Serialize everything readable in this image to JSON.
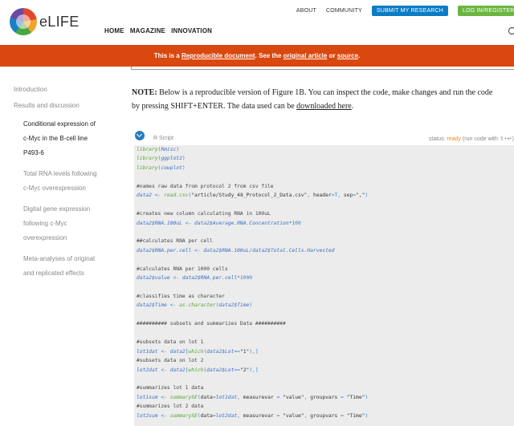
{
  "header": {
    "logo_text": "eLIFE",
    "utility_links": [
      "ABOUT",
      "COMMUNITY"
    ],
    "submit_label": "SUBMIT MY RESEARCH",
    "login_label": "LOG IN/REGISTER",
    "nav": [
      "HOME",
      "MAGAZINE",
      "INNOVATION"
    ]
  },
  "banner": {
    "prefix": "This is a ",
    "link1": "Reproducible document",
    "mid": ". See the ",
    "link2": "original article",
    "or": " or ",
    "link3": "source",
    "suffix": "."
  },
  "sidebar": {
    "items": [
      "Introduction",
      "Results and discussion",
      "Conditional expression of",
      "c-Myc in the B-cell line",
      "P493-6",
      "Total RNA levels following",
      "c-Myc overexpression",
      "Digital gene expression",
      "following c-Myc",
      "overexpression",
      "Meta-analyses of original",
      "and replicated effects"
    ]
  },
  "note": {
    "bold": "NOTE:",
    "text": " Below is a reproducible version of Figure 1B. You can inspect the code, make changes and run the code by pressing SHIFT+ENTER. The data used can be ",
    "link": "downloaded here",
    "suffix": "."
  },
  "code_panel": {
    "label": "R Script",
    "status_prefix": "status: ",
    "status_value": "ready",
    "status_suffix": " (run code with ⇧+↵)",
    "colors": {
      "function": "#55a630",
      "variable": "#3a6fc4",
      "background": "#ececec",
      "accent": "#2a7ac0"
    },
    "lines": [
      "library(Rmisc)",
      "library(ggplot2)",
      "library(cowplot)",
      "",
      "#names raw data from protocol 2 from csv file",
      "data2 <- read.csv(\"article/Study_48_Protocol_2_Data.csv\", header=T, sep=\",\")",
      "",
      "#creates new column calculating RNA in 100uL",
      "data2$RNA.100uL <- data2$Average.RNA.Concentration*100",
      "",
      "##calculates RNA per cell",
      "data2$RNA.per.cell <- data2$RNA.100uL/data2$Total.Cells.Harvested",
      "",
      "#calculates RNA per 1000 cells",
      "data2$value <- data2$RNA.per.cell*1000",
      "",
      "#classifies time as character",
      "data2$Time <- as.character(data2$Time)",
      "",
      "########## subsets and summarizes Data ##########",
      "",
      "#subsets data on lot 1",
      "lot1dat <- data2[which(data2$Lot==\"1\"),]",
      "#subsets data on lot 2",
      "lot2dat <- data2[which(data2$Lot==\"2\"),]",
      "",
      "#summarizes lot 1 data",
      "lot1sum <- summarySE(data=lot1dat, measurevar = \"value\", groupvars = \"Time\")",
      "#summarizes lot 2 data",
      "lot2sum <- summarySE(data=lot2dat, measurevar = \"value\", groupvars = \"Time\")",
      ""
    ]
  }
}
